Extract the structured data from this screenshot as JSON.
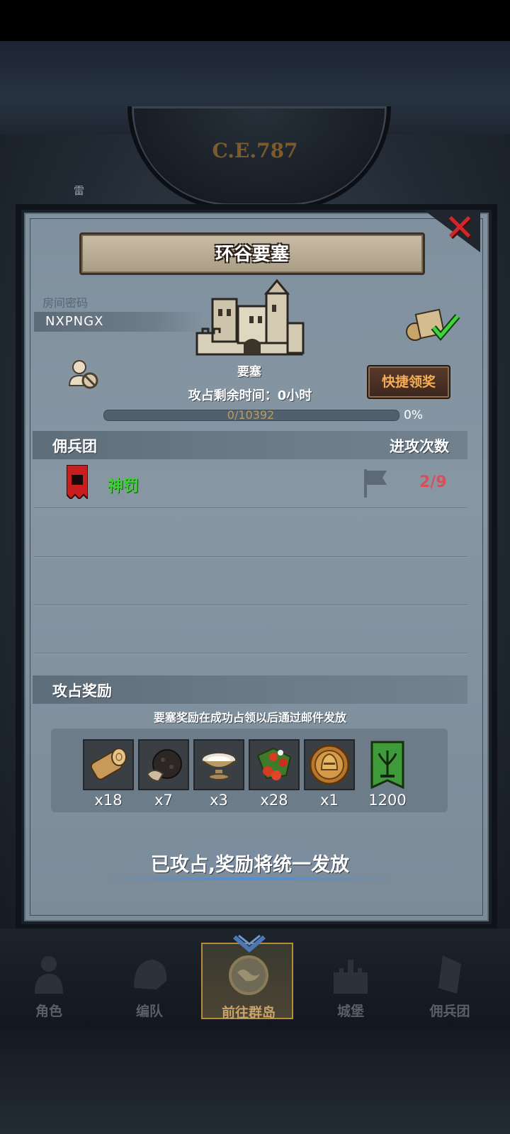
{
  "background": {
    "year": "C.E.787",
    "side_label": "雷"
  },
  "dialog": {
    "title": "环谷要塞",
    "room_password_label": "房间密码",
    "room_password": "NXPNGX",
    "fortress_label": "要塞",
    "quick_claim_button": "快捷领奖",
    "timer_text": "攻占剩余时间：0小时",
    "progress": {
      "text": "0/10392",
      "percent": "0%",
      "fraction": 0
    },
    "mercenary_section": {
      "left_header": "佣兵团",
      "right_header": "进攻次数",
      "rows": [
        {
          "name": "神罚",
          "attacks": "2/9"
        }
      ]
    },
    "reward_section": {
      "header": "攻占奖励",
      "note": "要塞奖励在成功占领以后通过邮件发放",
      "items": [
        {
          "icon": "wood-log-icon",
          "qty": "x18"
        },
        {
          "icon": "truffle-icon",
          "qty": "x7"
        },
        {
          "icon": "milk-bowl-icon",
          "qty": "x3"
        },
        {
          "icon": "berries-icon",
          "qty": "x28"
        },
        {
          "icon": "helmet-medal-icon",
          "qty": "x1"
        },
        {
          "icon": "guild-banner-icon",
          "qty": "1200"
        }
      ]
    },
    "claim_status": "已攻占,奖励将统一发放"
  },
  "bottom_nav": {
    "items": [
      {
        "label": "角色"
      },
      {
        "label": "编队"
      },
      {
        "label": "前往群岛"
      },
      {
        "label": "城堡"
      },
      {
        "label": "佣兵团"
      }
    ],
    "active_index": 2
  },
  "colors": {
    "guild_name": "#3bd332",
    "attack_count": "#d5505a",
    "quick_claim_text": "#f5ad54",
    "close_x": "#d0282a"
  }
}
